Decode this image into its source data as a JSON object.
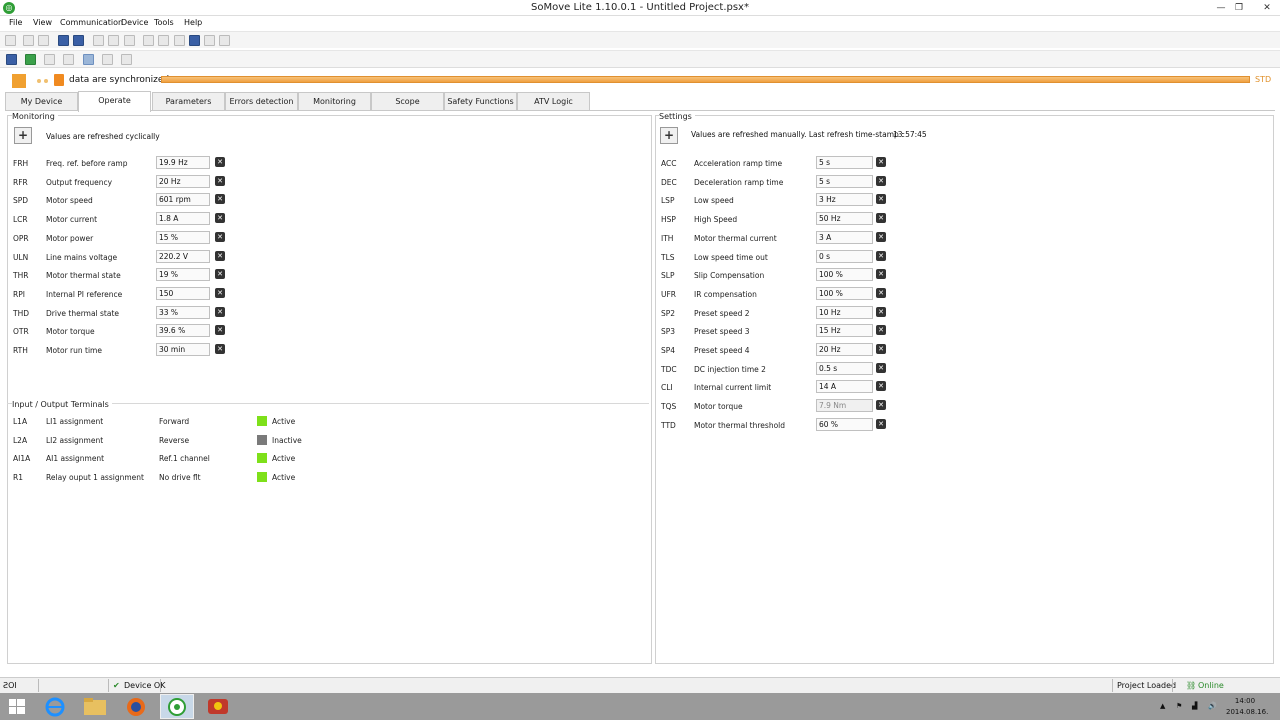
{
  "window": {
    "title": "SoMove Lite 1.10.0.1 - Untitled Project.psx*"
  },
  "menu": [
    "File",
    "View",
    "Communication",
    "Device",
    "Tools",
    "Help"
  ],
  "status_bar": {
    "sync_label": "data are synchronized",
    "mode": "STD"
  },
  "tabs": [
    "My Device",
    "Operate",
    "Parameters",
    "Errors detection",
    "Monitoring",
    "Scope",
    "Safety Functions",
    "ATV Logic"
  ],
  "active_tab": "Operate",
  "monitoring": {
    "title": "Monitoring",
    "refresh_note": "Values are refreshed cyclically",
    "rows": [
      {
        "code": "FRH",
        "label": "Freq. ref. before ramp",
        "value": "19.9 Hz"
      },
      {
        "code": "RFR",
        "label": "Output frequency",
        "value": "20 Hz"
      },
      {
        "code": "SPD",
        "label": "Motor speed",
        "value": "601 rpm"
      },
      {
        "code": "LCR",
        "label": "Motor current",
        "value": "1.8 A"
      },
      {
        "code": "OPR",
        "label": "Motor power",
        "value": "15 %"
      },
      {
        "code": "ULN",
        "label": "Line mains voltage",
        "value": "220.2 V"
      },
      {
        "code": "THR",
        "label": "Motor thermal state",
        "value": "19 %"
      },
      {
        "code": "RPI",
        "label": "Internal PI reference",
        "value": "150"
      },
      {
        "code": "THD",
        "label": "Drive thermal state",
        "value": "33 %"
      },
      {
        "code": "OTR",
        "label": "Motor torque",
        "value": "39.6 %"
      },
      {
        "code": "RTH",
        "label": "Motor run time",
        "value": "30 min"
      }
    ]
  },
  "io": {
    "title": "Input / Output Terminals",
    "rows": [
      {
        "code": "L1A",
        "label": "LI1 assignment",
        "value": "Forward",
        "state": "Active",
        "color": "#7ee01a"
      },
      {
        "code": "L2A",
        "label": "LI2 assignment",
        "value": "Reverse",
        "state": "Inactive",
        "color": "#7a7a7a"
      },
      {
        "code": "AI1A",
        "label": "AI1 assignment",
        "value": "Ref.1 channel",
        "state": "Active",
        "color": "#7ee01a"
      },
      {
        "code": "R1",
        "label": "Relay ouput 1 assignment",
        "value": "No drive flt",
        "state": "Active",
        "color": "#7ee01a"
      }
    ]
  },
  "settings": {
    "title": "Settings",
    "refresh_note": "Values are refreshed manually. Last refresh time-stamp :",
    "timestamp": "13:57:45",
    "rows": [
      {
        "code": "ACC",
        "label": "Acceleration ramp time",
        "value": "5 s"
      },
      {
        "code": "DEC",
        "label": "Deceleration ramp time",
        "value": "5 s"
      },
      {
        "code": "LSP",
        "label": "Low speed",
        "value": "3 Hz"
      },
      {
        "code": "HSP",
        "label": "High Speed",
        "value": "50 Hz"
      },
      {
        "code": "ITH",
        "label": "Motor thermal current",
        "value": "3 A"
      },
      {
        "code": "TLS",
        "label": "Low speed time out",
        "value": "0 s"
      },
      {
        "code": "SLP",
        "label": "Slip Compensation",
        "value": "100 %"
      },
      {
        "code": "UFR",
        "label": "IR compensation",
        "value": "100 %"
      },
      {
        "code": "SP2",
        "label": "Preset speed 2",
        "value": "10 Hz"
      },
      {
        "code": "SP3",
        "label": "Preset speed 3",
        "value": "15 Hz"
      },
      {
        "code": "SP4",
        "label": "Preset speed 4",
        "value": "20 Hz"
      },
      {
        "code": "TDC",
        "label": "DC injection time 2",
        "value": "0.5 s"
      },
      {
        "code": "CLI",
        "label": "Internal current limit",
        "value": "14 A"
      },
      {
        "code": "TQS",
        "label": "Motor torque",
        "value": "7.9 Nm",
        "readonly": true
      },
      {
        "code": "TTD",
        "label": "Motor thermal threshold",
        "value": "60 %"
      }
    ]
  },
  "bottom_status": {
    "left": "ƧOI",
    "device": "Device OK",
    "project": "Project Loaded",
    "online": "Online"
  },
  "taskbar": {
    "time": "14:00",
    "date": "2014.08.16."
  }
}
